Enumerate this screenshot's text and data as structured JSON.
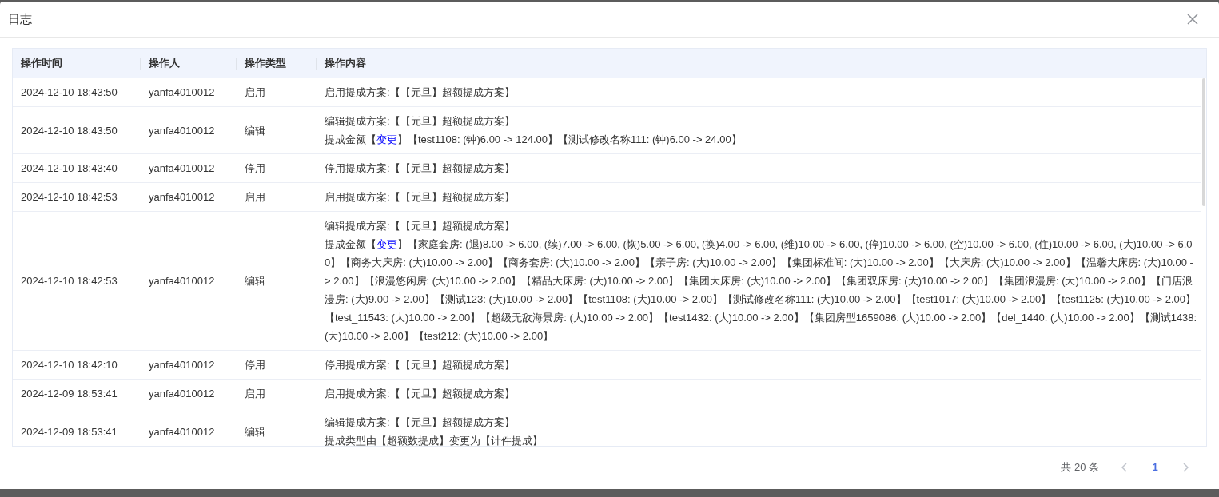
{
  "dialog": {
    "title": "日志"
  },
  "table": {
    "columns": [
      "操作时间",
      "操作人",
      "操作类型",
      "操作内容"
    ],
    "rows": [
      {
        "time": "2024-12-10 18:43:50",
        "operator": "yanfa4010012",
        "type": "启用",
        "lines": [
          [
            {
              "kind": "plain",
              "text": "启用提成方案:【【元旦】超额提成方案】"
            }
          ]
        ]
      },
      {
        "time": "2024-12-10 18:43:50",
        "operator": "yanfa4010012",
        "type": "编辑",
        "lines": [
          [
            {
              "kind": "plain",
              "text": "编辑提成方案:【【元旦】超额提成方案】"
            }
          ],
          [
            {
              "kind": "plain",
              "text": "提成金额【"
            },
            {
              "kind": "link",
              "text": "变更"
            },
            {
              "kind": "plain",
              "text": "】【test1108: (钟)6.00 -> 124.00】【测试修改名称111: (钟)6.00 -> 24.00】"
            }
          ]
        ]
      },
      {
        "time": "2024-12-10 18:43:40",
        "operator": "yanfa4010012",
        "type": "停用",
        "lines": [
          [
            {
              "kind": "plain",
              "text": "停用提成方案:【【元旦】超额提成方案】"
            }
          ]
        ]
      },
      {
        "time": "2024-12-10 18:42:53",
        "operator": "yanfa4010012",
        "type": "启用",
        "lines": [
          [
            {
              "kind": "plain",
              "text": "启用提成方案:【【元旦】超额提成方案】"
            }
          ]
        ]
      },
      {
        "time": "2024-12-10 18:42:53",
        "operator": "yanfa4010012",
        "type": "编辑",
        "lines": [
          [
            {
              "kind": "plain",
              "text": "编辑提成方案:【【元旦】超额提成方案】"
            }
          ],
          [
            {
              "kind": "plain",
              "text": "提成金额【"
            },
            {
              "kind": "link",
              "text": "变更"
            },
            {
              "kind": "plain",
              "text": "】【家庭套房: (退)8.00 -> 6.00, (续)7.00 -> 6.00, (恢)5.00 -> 6.00, (换)4.00 -> 6.00, (维)10.00 -> 6.00, (停)10.00 -> 6.00, (空)10.00 -> 6.00, (住)10.00 -> 6.00, (大)10.00 -> 6.00】【商务大床房: (大)10.00 -> 2.00】【商务套房: (大)10.00 -> 2.00】【亲子房: (大)10.00 -> 2.00】【集团标准间: (大)10.00 -> 2.00】【大床房: (大)10.00 -> 2.00】【温馨大床房: (大)10.00 -> 2.00】【浪漫悠闲房: (大)10.00 -> 2.00】【精品大床房: (大)10.00 -> 2.00】【集团大床房: (大)10.00 -> 2.00】【集团双床房: (大)10.00 -> 2.00】【集团浪漫房: (大)10.00 -> 2.00】【门店浪漫房: (大)9.00 -> 2.00】【测试123: (大)10.00 -> 2.00】【test1108: (大)10.00 -> 2.00】【测试修改名称111: (大)10.00 -> 2.00】【test1017: (大)10.00 -> 2.00】【test1125: (大)10.00 -> 2.00】【test_11543: (大)10.00 -> 2.00】【超级无敌海景房: (大)10.00 -> 2.00】【test1432: (大)10.00 -> 2.00】【集团房型1659086: (大)10.00 -> 2.00】【del_1440: (大)10.00 -> 2.00】【测试1438: (大)10.00 -> 2.00】【test212: (大)10.00 -> 2.00】"
            }
          ]
        ]
      },
      {
        "time": "2024-12-10 18:42:10",
        "operator": "yanfa4010012",
        "type": "停用",
        "lines": [
          [
            {
              "kind": "plain",
              "text": "停用提成方案:【【元旦】超额提成方案】"
            }
          ]
        ]
      },
      {
        "time": "2024-12-09 18:53:41",
        "operator": "yanfa4010012",
        "type": "启用",
        "lines": [
          [
            {
              "kind": "plain",
              "text": "启用提成方案:【【元旦】超额提成方案】"
            }
          ]
        ]
      },
      {
        "time": "2024-12-09 18:53:41",
        "operator": "yanfa4010012",
        "type": "编辑",
        "lines": [
          [
            {
              "kind": "plain",
              "text": "编辑提成方案:【【元旦】超额提成方案】"
            }
          ],
          [
            {
              "kind": "plain",
              "text": "提成类型由【超额数提成】变更为【计件提成】"
            }
          ]
        ]
      }
    ]
  },
  "pagination": {
    "total": "共 20 条",
    "pages": [
      {
        "label": "1",
        "selected": true
      }
    ]
  }
}
